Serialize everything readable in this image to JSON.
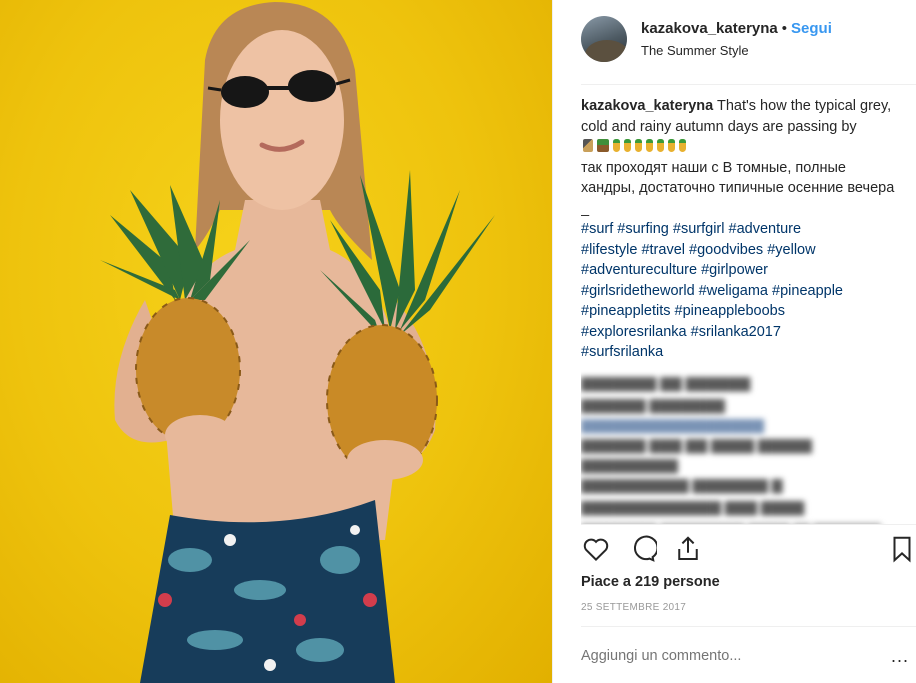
{
  "post": {
    "photo_icon": "photo-of-person-holding-pineapples",
    "colors": {
      "background": "#f0c510",
      "link": "#3897f0",
      "hashtag": "#003569"
    }
  },
  "header": {
    "username": "kazakova_kateryna",
    "separator": "•",
    "follow_label": "Segui",
    "location": "The Summer Style"
  },
  "caption": {
    "author": "kazakova_kateryna",
    "line1": "That's how the typical grey, cold and rainy autumn days are passing by",
    "line2": "так проходят наши с В томные, полные хандры, достаточно типичные осенние вечера",
    "line3": "_",
    "hashtags": [
      "#surf",
      "#surfing",
      "#surfgirl",
      "#adventure",
      "#lifestyle",
      "#travel",
      "#goodvibes",
      "#yellow",
      "#adventureculture",
      "#girlpower",
      "#girlsridetheworld",
      "#weligama",
      "#pineapple",
      "#pineappletits",
      "#pineappleboobs",
      "#exploresrilanka",
      "#srilanka2017",
      "#surfsrilanka"
    ]
  },
  "actions": {
    "like_icon": "heart-icon",
    "comment_icon": "comment-icon",
    "share_icon": "share-icon",
    "save_icon": "bookmark-icon"
  },
  "likes_text": "Piace a 219 persone",
  "date_text": "25 SETTEMBRE 2017",
  "comment_box": {
    "placeholder": "Aggiungi un commento..."
  },
  "more_label": "..."
}
